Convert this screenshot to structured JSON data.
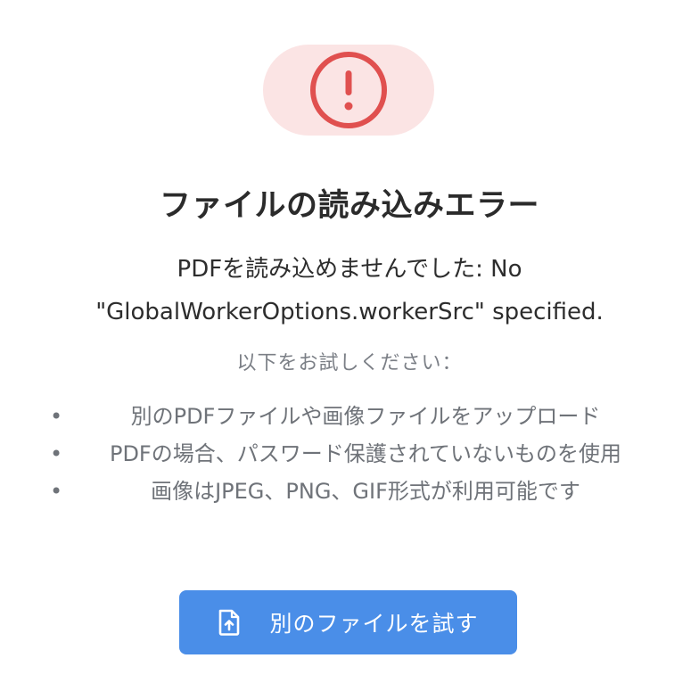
{
  "error_icon": {
    "name": "exclamation-circle-icon",
    "color": "#e0504f",
    "background": "#fbe4e4"
  },
  "title": "ファイルの読み込みエラー",
  "message": {
    "line1": "PDFを読み込めませんでした: No",
    "line2": "\"GlobalWorkerOptions.workerSrc\" specified."
  },
  "hint": "以下をお試しください：",
  "suggestions": [
    "別のPDFファイルや画像ファイルをアップロード",
    "PDFの場合、パスワード保護されていないものを使用",
    "画像はJPEG、PNG、GIF形式が利用可能です"
  ],
  "bullet": "•",
  "retry_button": {
    "label": "別のファイルを試す",
    "icon": "file-upload-icon",
    "color": "#4a8ee8"
  }
}
